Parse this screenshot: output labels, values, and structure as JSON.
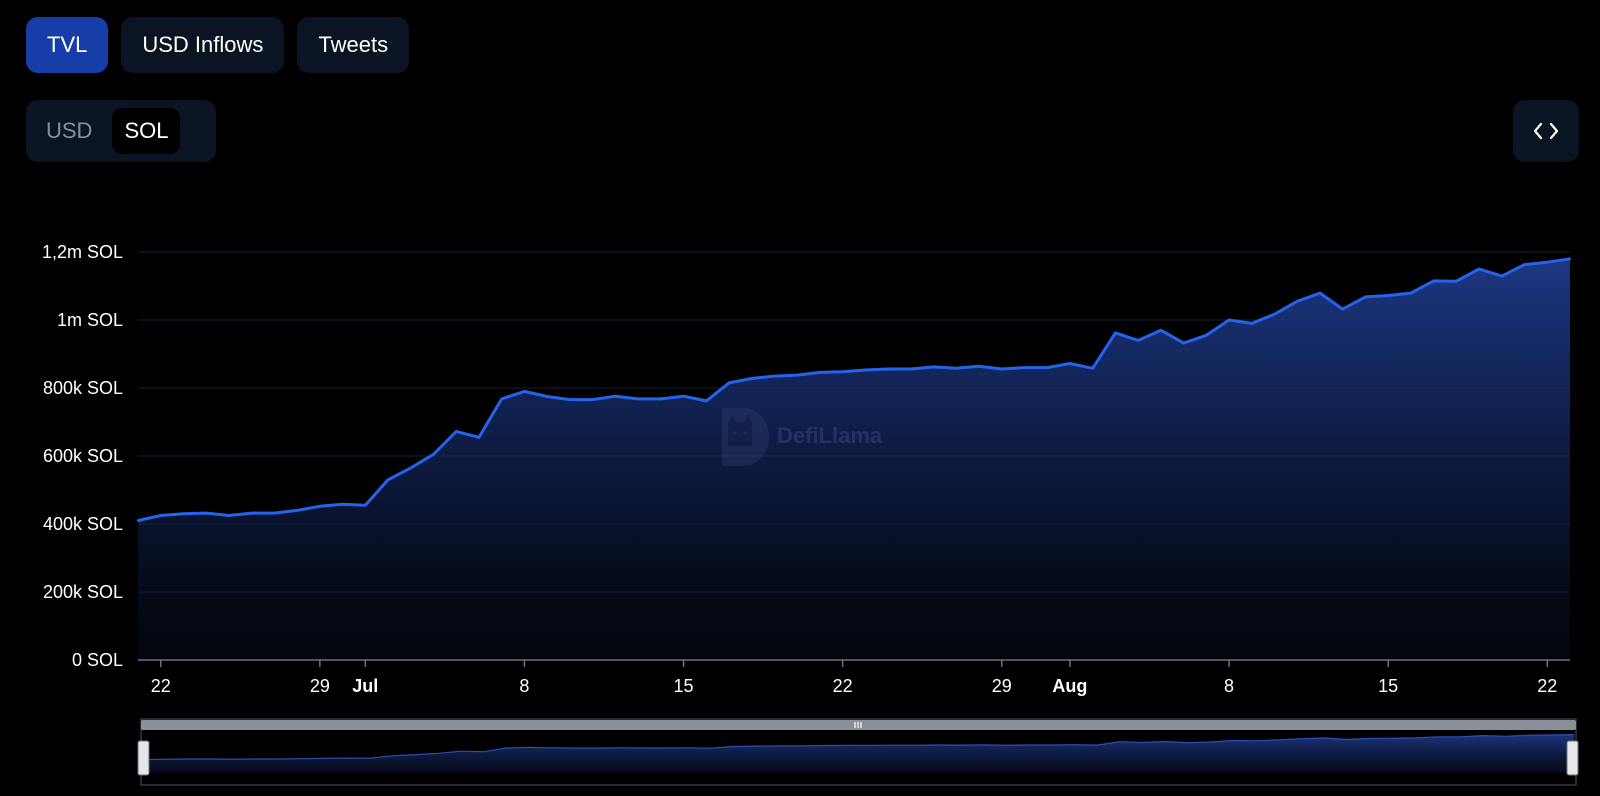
{
  "tabs": [
    {
      "label": "TVL",
      "active": true
    },
    {
      "label": "USD Inflows",
      "active": false
    },
    {
      "label": "Tweets",
      "active": false
    }
  ],
  "unit_toggle": {
    "options": [
      {
        "label": "USD",
        "active": false
      },
      {
        "label": "SOL",
        "active": true
      }
    ]
  },
  "embed_button": {
    "icon": "code-brackets-icon"
  },
  "watermark": {
    "text": "DefiLlama",
    "icon": "llama-logo-icon"
  },
  "colors": {
    "background": "#000000",
    "line": "#2563eb",
    "area_top": "#1e3a8a",
    "tab_active": "#173ea8",
    "tab_inactive": "#0b1422"
  },
  "chart_data": {
    "type": "area",
    "unit_suffix": " SOL",
    "ylim": [
      0,
      1200000
    ],
    "y_ticks": [
      {
        "value": 0,
        "label": "0 SOL"
      },
      {
        "value": 200000,
        "label": "200k SOL"
      },
      {
        "value": 400000,
        "label": "400k SOL"
      },
      {
        "value": 600000,
        "label": "600k SOL"
      },
      {
        "value": 800000,
        "label": "800k SOL"
      },
      {
        "value": 1000000,
        "label": "1m SOL"
      },
      {
        "value": 1200000,
        "label": "1,2m SOL"
      }
    ],
    "x_start": "06-21",
    "x_end": "08-23",
    "x_ticks": [
      {
        "date": "06-22",
        "label": "22",
        "bold": false
      },
      {
        "date": "06-29",
        "label": "29",
        "bold": false
      },
      {
        "date": "07-01",
        "label": "Jul",
        "bold": true
      },
      {
        "date": "07-08",
        "label": "8",
        "bold": false
      },
      {
        "date": "07-15",
        "label": "15",
        "bold": false
      },
      {
        "date": "07-22",
        "label": "22",
        "bold": false
      },
      {
        "date": "07-29",
        "label": "29",
        "bold": false
      },
      {
        "date": "08-01",
        "label": "Aug",
        "bold": true
      },
      {
        "date": "08-08",
        "label": "8",
        "bold": false
      },
      {
        "date": "08-15",
        "label": "15",
        "bold": false
      },
      {
        "date": "08-22",
        "label": "22",
        "bold": false
      }
    ],
    "series": [
      {
        "x": [
          "06-21",
          "06-22",
          "06-23",
          "06-24",
          "06-25",
          "06-26",
          "06-27",
          "06-28",
          "06-29",
          "06-30",
          "07-01",
          "07-02",
          "07-03",
          "07-04",
          "07-05",
          "07-06",
          "07-07",
          "07-08",
          "07-09",
          "07-10",
          "07-11",
          "07-12",
          "07-13",
          "07-14",
          "07-15",
          "07-16",
          "07-17",
          "07-18",
          "07-19",
          "07-20",
          "07-21",
          "07-22",
          "07-23",
          "07-24",
          "07-25",
          "07-26",
          "07-27",
          "07-28",
          "07-29",
          "07-30",
          "07-31",
          "08-01",
          "08-02",
          "08-03",
          "08-04",
          "08-05",
          "08-06",
          "08-07",
          "08-08",
          "08-09",
          "08-10",
          "08-11",
          "08-12",
          "08-13",
          "08-14",
          "08-15",
          "08-16",
          "08-17",
          "08-18",
          "08-19",
          "08-20",
          "08-21",
          "08-22",
          "08-23"
        ],
        "values": [
          410000,
          425000,
          430000,
          432000,
          425000,
          432000,
          432000,
          440000,
          452000,
          458000,
          455000,
          530000,
          565000,
          605000,
          672000,
          655000,
          768000,
          790000,
          775000,
          766000,
          766000,
          776000,
          768000,
          768000,
          776000,
          762000,
          815000,
          828000,
          835000,
          838000,
          846000,
          848000,
          853000,
          856000,
          856000,
          862000,
          858000,
          864000,
          856000,
          860000,
          860000,
          872000,
          858000,
          962000,
          940000,
          970000,
          932000,
          955000,
          1000000,
          990000,
          1017000,
          1055000,
          1079000,
          1032000,
          1068000,
          1072000,
          1079000,
          1115000,
          1114000,
          1150000,
          1129000,
          1163000,
          1170000,
          1180000
        ]
      }
    ]
  }
}
